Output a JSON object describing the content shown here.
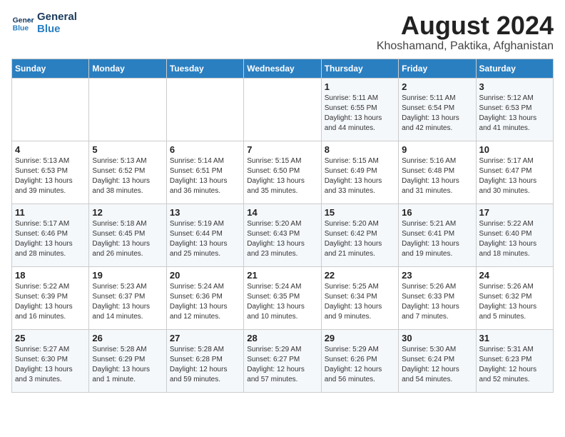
{
  "header": {
    "logo_line1": "General",
    "logo_line2": "Blue",
    "month_year": "August 2024",
    "location": "Khoshamand, Paktika, Afghanistan"
  },
  "weekdays": [
    "Sunday",
    "Monday",
    "Tuesday",
    "Wednesday",
    "Thursday",
    "Friday",
    "Saturday"
  ],
  "weeks": [
    [
      {
        "day": "",
        "detail": ""
      },
      {
        "day": "",
        "detail": ""
      },
      {
        "day": "",
        "detail": ""
      },
      {
        "day": "",
        "detail": ""
      },
      {
        "day": "1",
        "detail": "Sunrise: 5:11 AM\nSunset: 6:55 PM\nDaylight: 13 hours\nand 44 minutes."
      },
      {
        "day": "2",
        "detail": "Sunrise: 5:11 AM\nSunset: 6:54 PM\nDaylight: 13 hours\nand 42 minutes."
      },
      {
        "day": "3",
        "detail": "Sunrise: 5:12 AM\nSunset: 6:53 PM\nDaylight: 13 hours\nand 41 minutes."
      }
    ],
    [
      {
        "day": "4",
        "detail": "Sunrise: 5:13 AM\nSunset: 6:53 PM\nDaylight: 13 hours\nand 39 minutes."
      },
      {
        "day": "5",
        "detail": "Sunrise: 5:13 AM\nSunset: 6:52 PM\nDaylight: 13 hours\nand 38 minutes."
      },
      {
        "day": "6",
        "detail": "Sunrise: 5:14 AM\nSunset: 6:51 PM\nDaylight: 13 hours\nand 36 minutes."
      },
      {
        "day": "7",
        "detail": "Sunrise: 5:15 AM\nSunset: 6:50 PM\nDaylight: 13 hours\nand 35 minutes."
      },
      {
        "day": "8",
        "detail": "Sunrise: 5:15 AM\nSunset: 6:49 PM\nDaylight: 13 hours\nand 33 minutes."
      },
      {
        "day": "9",
        "detail": "Sunrise: 5:16 AM\nSunset: 6:48 PM\nDaylight: 13 hours\nand 31 minutes."
      },
      {
        "day": "10",
        "detail": "Sunrise: 5:17 AM\nSunset: 6:47 PM\nDaylight: 13 hours\nand 30 minutes."
      }
    ],
    [
      {
        "day": "11",
        "detail": "Sunrise: 5:17 AM\nSunset: 6:46 PM\nDaylight: 13 hours\nand 28 minutes."
      },
      {
        "day": "12",
        "detail": "Sunrise: 5:18 AM\nSunset: 6:45 PM\nDaylight: 13 hours\nand 26 minutes."
      },
      {
        "day": "13",
        "detail": "Sunrise: 5:19 AM\nSunset: 6:44 PM\nDaylight: 13 hours\nand 25 minutes."
      },
      {
        "day": "14",
        "detail": "Sunrise: 5:20 AM\nSunset: 6:43 PM\nDaylight: 13 hours\nand 23 minutes."
      },
      {
        "day": "15",
        "detail": "Sunrise: 5:20 AM\nSunset: 6:42 PM\nDaylight: 13 hours\nand 21 minutes."
      },
      {
        "day": "16",
        "detail": "Sunrise: 5:21 AM\nSunset: 6:41 PM\nDaylight: 13 hours\nand 19 minutes."
      },
      {
        "day": "17",
        "detail": "Sunrise: 5:22 AM\nSunset: 6:40 PM\nDaylight: 13 hours\nand 18 minutes."
      }
    ],
    [
      {
        "day": "18",
        "detail": "Sunrise: 5:22 AM\nSunset: 6:39 PM\nDaylight: 13 hours\nand 16 minutes."
      },
      {
        "day": "19",
        "detail": "Sunrise: 5:23 AM\nSunset: 6:37 PM\nDaylight: 13 hours\nand 14 minutes."
      },
      {
        "day": "20",
        "detail": "Sunrise: 5:24 AM\nSunset: 6:36 PM\nDaylight: 13 hours\nand 12 minutes."
      },
      {
        "day": "21",
        "detail": "Sunrise: 5:24 AM\nSunset: 6:35 PM\nDaylight: 13 hours\nand 10 minutes."
      },
      {
        "day": "22",
        "detail": "Sunrise: 5:25 AM\nSunset: 6:34 PM\nDaylight: 13 hours\nand 9 minutes."
      },
      {
        "day": "23",
        "detail": "Sunrise: 5:26 AM\nSunset: 6:33 PM\nDaylight: 13 hours\nand 7 minutes."
      },
      {
        "day": "24",
        "detail": "Sunrise: 5:26 AM\nSunset: 6:32 PM\nDaylight: 13 hours\nand 5 minutes."
      }
    ],
    [
      {
        "day": "25",
        "detail": "Sunrise: 5:27 AM\nSunset: 6:30 PM\nDaylight: 13 hours\nand 3 minutes."
      },
      {
        "day": "26",
        "detail": "Sunrise: 5:28 AM\nSunset: 6:29 PM\nDaylight: 13 hours\nand 1 minute."
      },
      {
        "day": "27",
        "detail": "Sunrise: 5:28 AM\nSunset: 6:28 PM\nDaylight: 12 hours\nand 59 minutes."
      },
      {
        "day": "28",
        "detail": "Sunrise: 5:29 AM\nSunset: 6:27 PM\nDaylight: 12 hours\nand 57 minutes."
      },
      {
        "day": "29",
        "detail": "Sunrise: 5:29 AM\nSunset: 6:26 PM\nDaylight: 12 hours\nand 56 minutes."
      },
      {
        "day": "30",
        "detail": "Sunrise: 5:30 AM\nSunset: 6:24 PM\nDaylight: 12 hours\nand 54 minutes."
      },
      {
        "day": "31",
        "detail": "Sunrise: 5:31 AM\nSunset: 6:23 PM\nDaylight: 12 hours\nand 52 minutes."
      }
    ]
  ]
}
